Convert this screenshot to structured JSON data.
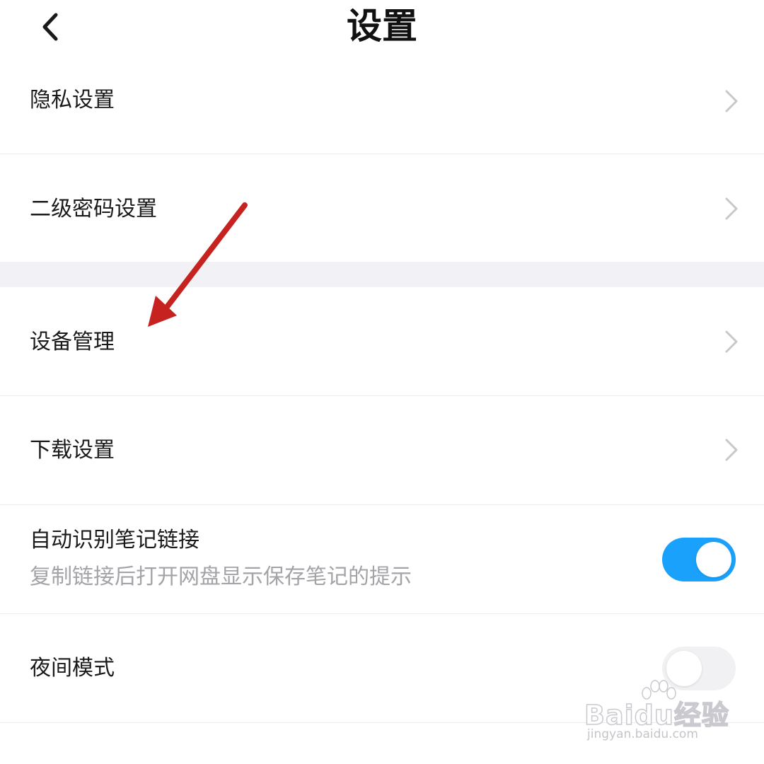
{
  "header": {
    "title": "设置",
    "back_icon": "chevron-left-icon"
  },
  "settings": {
    "privacy": {
      "label": "隐私设置"
    },
    "secondary_password": {
      "label": "二级密码设置"
    },
    "device_management": {
      "label": "设备管理"
    },
    "download": {
      "label": "下载设置"
    },
    "auto_detect_note_links": {
      "label": "自动识别笔记链接",
      "description": "复制链接后打开网盘显示保存笔记的提示",
      "enabled": true
    },
    "night_mode": {
      "label": "夜间模式",
      "enabled": false
    }
  },
  "watermark": {
    "brand": "Baidu经验",
    "url": "jingyan.baidu.com"
  },
  "colors": {
    "toggle_on": "#1aa1fb",
    "toggle_off": "#f1f1f3",
    "section_gap": "#f2f2f6",
    "annotation_arrow": "#c6221f",
    "secondary_text": "#a3a3a8"
  }
}
